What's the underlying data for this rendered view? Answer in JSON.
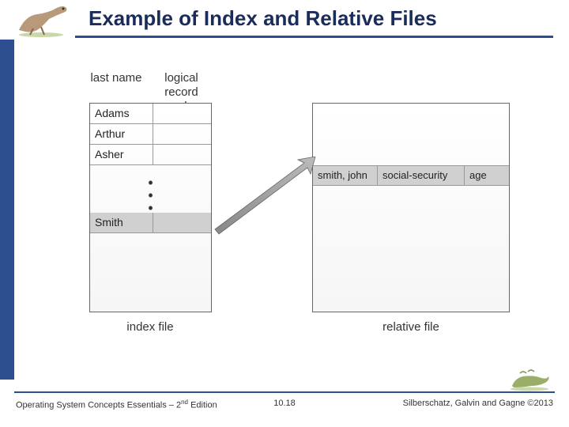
{
  "title": "Example of Index and Relative Files",
  "headers": {
    "lastname": "last name",
    "lognum_line1": "logical record",
    "lognum_line2": "number"
  },
  "index_entries": [
    "Adams",
    "Arthur",
    "Asher"
  ],
  "index_highlight": "Smith",
  "record": {
    "name": "smith, john",
    "field2": "social-security",
    "field3": "age"
  },
  "captions": {
    "index": "index file",
    "relative": "relative file"
  },
  "footer": {
    "left_prefix": "Operating System Concepts Essentials – 2",
    "left_sup": "nd",
    "left_suffix": " Edition",
    "center": "10.18",
    "right": "Silberschatz, Galvin and Gagne ©2013"
  },
  "icons": {
    "dino_left": "dinosaur-running-icon",
    "dino_right": "dinosaur-crouching-icon"
  }
}
